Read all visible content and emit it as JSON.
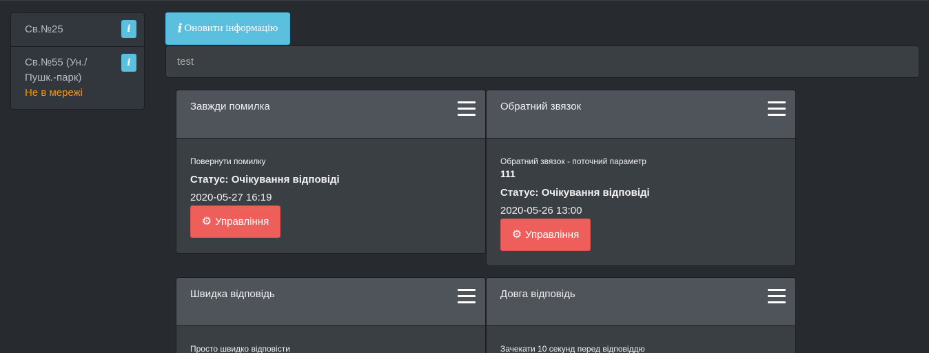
{
  "sidebar": {
    "items": [
      {
        "label": "Св.№25",
        "status": ""
      },
      {
        "label": "Св.№55 (Ун./Пушк.-парк)",
        "status": "Не в мережі"
      }
    ],
    "info_glyph": "i"
  },
  "toolbar": {
    "refresh_icon": "i",
    "refresh_label": "Оновити інформацію"
  },
  "title_bar": {
    "text": "test"
  },
  "cards": [
    {
      "title": "Завжди помилка",
      "description": "Повернути помилку",
      "param": "",
      "status": "Статус: Очікування відповіді",
      "date": "2020-05-27 16:19",
      "button": "Управління"
    },
    {
      "title": "Обратний звязок",
      "description": "Обратний звязок - поточний параметр",
      "param": "111",
      "status": "Статус: Очікування відповіді",
      "date": "2020-05-26 13:00",
      "button": "Управління"
    },
    {
      "title": "Швидка відповідь",
      "description": "Просто швидко відповісти"
    },
    {
      "title": "Довга відповідь",
      "description": "Зачекати 10 секунд перед відповіддю"
    }
  ],
  "colors": {
    "background": "#272b30",
    "info": "#5bc0de",
    "danger": "#ee5f5b",
    "warning": "#f89406"
  },
  "icons": {
    "info": "info-icon",
    "menu": "hamburger-menu-icon",
    "gear": "gear-icon"
  }
}
